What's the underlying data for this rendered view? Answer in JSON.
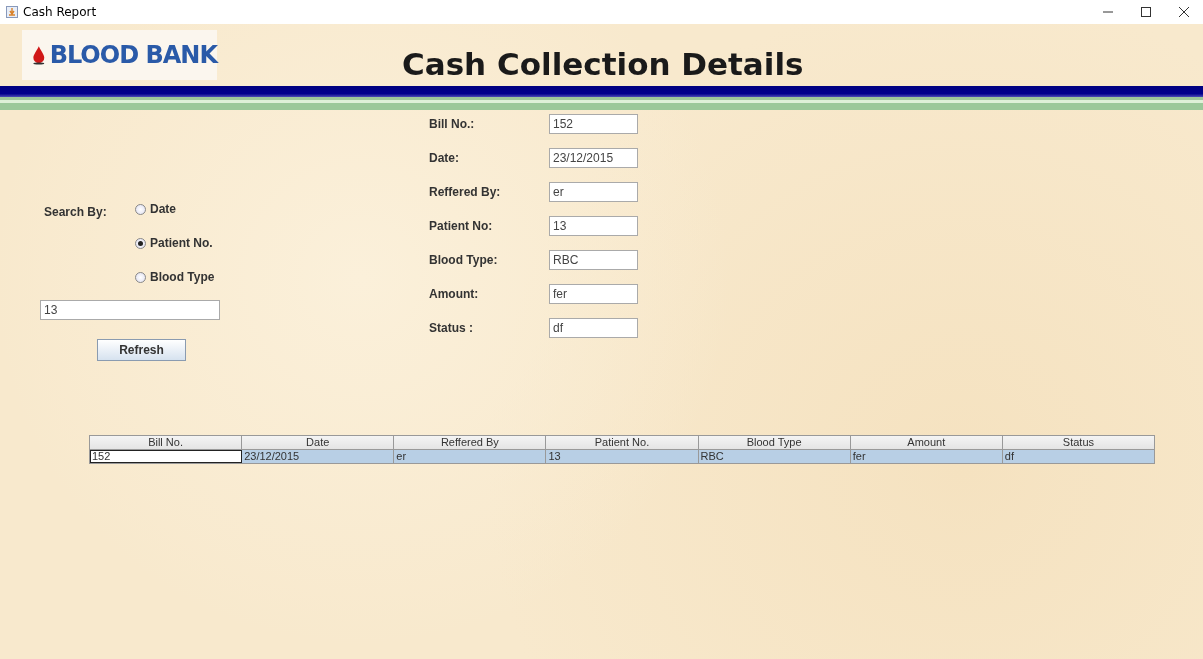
{
  "window": {
    "title": "Cash Report"
  },
  "header": {
    "logo_text": "BLOOD BANK",
    "title": "Cash Collection Details"
  },
  "search": {
    "label": "Search By:",
    "options": [
      {
        "label": "Date",
        "selected": false
      },
      {
        "label": "Patient No.",
        "selected": true
      },
      {
        "label": "Blood Type",
        "selected": false
      }
    ],
    "value": "13",
    "button": "Refresh"
  },
  "form": [
    {
      "label": "Bill No.:",
      "value": "152"
    },
    {
      "label": "Date:",
      "value": "23/12/2015"
    },
    {
      "label": "Reffered By:",
      "value": "er"
    },
    {
      "label": "Patient No:",
      "value": "13"
    },
    {
      "label": "Blood Type:",
      "value": "RBC"
    },
    {
      "label": "Amount:",
      "value": "fer"
    },
    {
      "label": "Status :",
      "value": "df"
    }
  ],
  "table": {
    "columns": [
      "Bill No.",
      "Date",
      "Reffered By",
      "Patient No.",
      "Blood Type",
      "Amount",
      "Status"
    ],
    "rows": [
      {
        "selected": true,
        "cells": [
          {
            "text": "152",
            "focused": true
          },
          {
            "text": "23/12/2015",
            "focused": false
          },
          {
            "text": "er",
            "focused": false
          },
          {
            "text": "13",
            "focused": false
          },
          {
            "text": "RBC",
            "focused": false
          },
          {
            "text": "fer",
            "focused": false
          },
          {
            "text": "df",
            "focused": false
          }
        ]
      }
    ]
  }
}
